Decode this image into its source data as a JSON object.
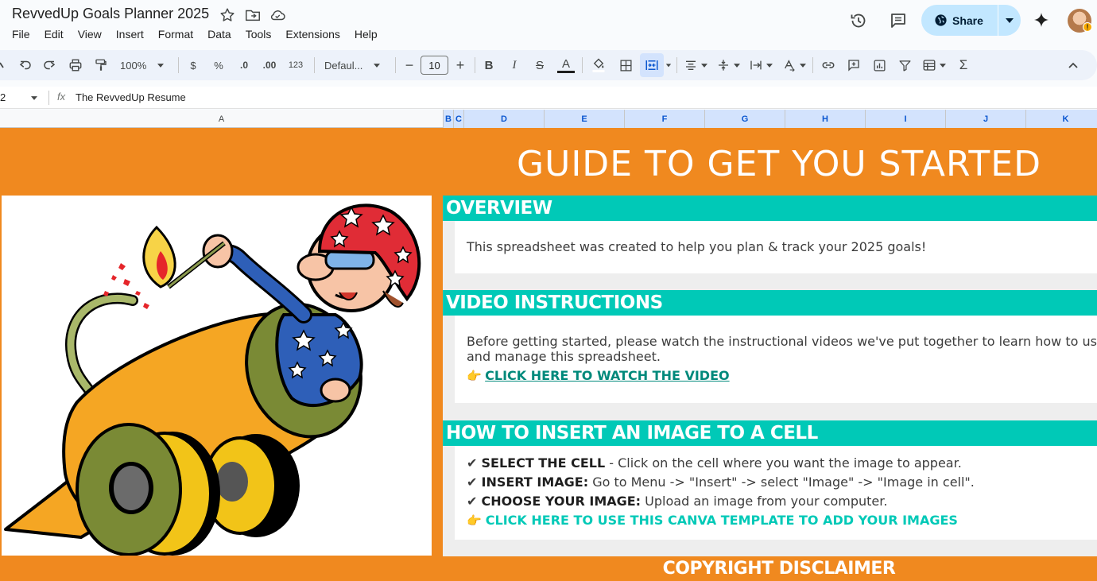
{
  "app": {
    "doc_title": "RevvedUp Goals Planner 2025",
    "share_label": "Share",
    "menus": [
      "File",
      "Edit",
      "View",
      "Insert",
      "Format",
      "Data",
      "Tools",
      "Extensions",
      "Help"
    ]
  },
  "toolbar": {
    "zoom": "100%",
    "currency": "$",
    "percent": "%",
    "decrease_decimals": ".0",
    "increase_decimals": ".00",
    "number_format": "123",
    "font": "Defaul...",
    "font_size": "10"
  },
  "formula_bar": {
    "name_box": "2",
    "fx": "fx",
    "content": "The RevvedUp Resume"
  },
  "columns": [
    "A",
    "B",
    "C",
    "D",
    "E",
    "F",
    "G",
    "H",
    "I",
    "J",
    "K"
  ],
  "sheet": {
    "banner_title": "GUIDE TO GET YOU STARTED",
    "overview": {
      "heading": "OVERVIEW",
      "text": "This spreadsheet was created to help you plan & track your 2025 goals!"
    },
    "video": {
      "heading": "VIDEO INSTRUCTIONS",
      "text_line1": "Before getting started, please watch the instructional videos we've put together to learn how to use",
      "text_line2": "and manage this spreadsheet.",
      "link_emoji": "👉",
      "link": "CLICK HERE TO WATCH THE VIDEO"
    },
    "insert_image": {
      "heading": "HOW TO INSERT AN IMAGE TO A CELL",
      "check": "✔",
      "steps": [
        {
          "bold": "SELECT THE CELL",
          "text": " - Click on the cell where you want the image to appear."
        },
        {
          "bold": "INSERT IMAGE:",
          "text": " Go to Menu -> \"Insert\" -> select \"Image\" -> \"Image in cell\"."
        },
        {
          "bold": "CHOOSE YOUR IMAGE:",
          "text": " Upload an image from your computer."
        }
      ],
      "link_emoji": "👉",
      "link": "CLICK HERE TO USE THIS CANVA TEMPLATE TO ADD YOUR IMAGES"
    },
    "footer_title": "COPYRIGHT DISCLAIMER"
  },
  "colors": {
    "orange": "#f0891f",
    "teal": "#00c9b7",
    "share_bg": "#c2e7ff"
  }
}
